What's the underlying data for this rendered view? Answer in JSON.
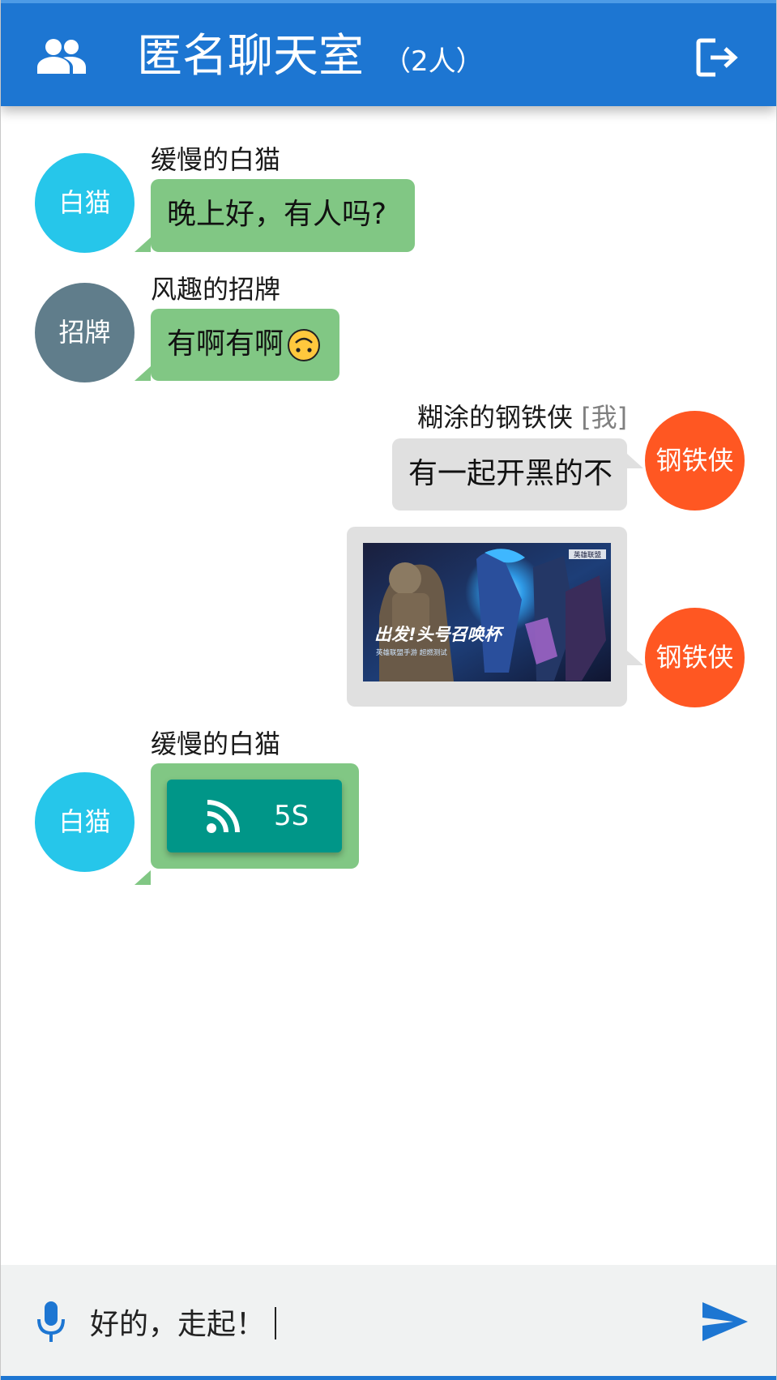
{
  "header": {
    "title": "匿名聊天室",
    "count": "（2人）",
    "users_icon": "group-icon",
    "exit_icon": "logout-icon"
  },
  "messages": [
    {
      "side": "left",
      "avatar": "白猫",
      "avatar_color": "#26c6ea",
      "nick": "缓慢的白猫",
      "type": "text",
      "text": "晚上好，有人吗?"
    },
    {
      "side": "left",
      "avatar": "招牌",
      "avatar_color": "#607d8b",
      "nick": "风趣的招牌",
      "type": "text",
      "text": "有啊有啊",
      "emoji": "upside-down-face-icon"
    },
    {
      "side": "right",
      "avatar": "钢铁侠",
      "avatar_color": "#ff5722",
      "nick": "糊涂的钢铁侠",
      "nick_tag": "[我]",
      "type": "text",
      "text": "有一起开黑的不"
    },
    {
      "side": "right",
      "avatar": "钢铁侠",
      "avatar_color": "#ff5722",
      "type": "image",
      "image": {
        "title": "出发!头号召唤杯",
        "subtitle": "英雄联盟手游  超燃测试",
        "logo": "英雄联盟"
      }
    },
    {
      "side": "left",
      "avatar": "白猫",
      "avatar_color": "#26c6ea",
      "nick": "缓慢的白猫",
      "type": "voice",
      "duration": "5S",
      "voice_icon": "rss-icon"
    }
  ],
  "input": {
    "value": "好的，走起！",
    "mic_icon": "microphone-icon",
    "send_icon": "send-icon"
  },
  "colors": {
    "primary": "#1d76d2",
    "bubble_other": "#81c784",
    "bubble_self": "#e0e0e0",
    "voice_button": "#009688"
  }
}
